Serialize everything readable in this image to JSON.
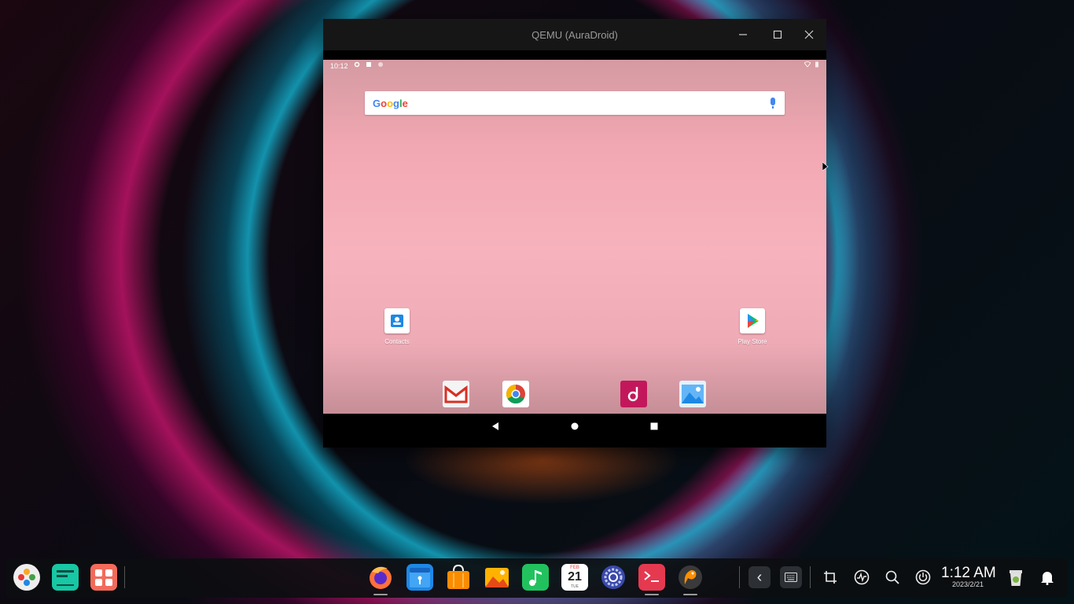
{
  "window": {
    "title": "QEMU (AuraDroid)",
    "minimize_glyph": "—",
    "maximize_glyph": "☐",
    "close_glyph": "✕"
  },
  "android": {
    "status_time": "10:12",
    "search_logo": "Google",
    "wallpaper_colors": [
      "#d49aa2",
      "#f7b3bd",
      "#c58e97"
    ],
    "home_apps": [
      {
        "label": "Contacts",
        "icon": "contacts-icon"
      },
      {
        "label": "Play Store",
        "icon": "play-store-icon"
      }
    ],
    "dock_apps": [
      {
        "icon": "gmail-icon"
      },
      {
        "icon": "chrome-icon"
      },
      {
        "icon": "music-icon"
      },
      {
        "icon": "gallery-icon"
      }
    ]
  },
  "taskbar": {
    "left_apps": [
      {
        "icon": "launcher-icon",
        "color": "#e9e9e9"
      },
      {
        "icon": "multitask-view-icon",
        "color": "#18c7a4"
      },
      {
        "icon": "app-store-icon",
        "color": "#f26b5b"
      }
    ],
    "pinned_apps": [
      {
        "icon": "firefox-icon"
      },
      {
        "icon": "file-manager-icon"
      },
      {
        "icon": "store-bag-icon"
      },
      {
        "icon": "image-viewer-icon"
      },
      {
        "icon": "music-player-icon"
      },
      {
        "icon": "calendar-icon",
        "month": "FEB",
        "day": "21",
        "weekday": "TUE"
      },
      {
        "icon": "settings-icon"
      },
      {
        "icon": "terminal-icon"
      },
      {
        "icon": "qemu-icon"
      }
    ],
    "tray": {
      "back_glyph": "‹",
      "clock_time": "1:12 AM",
      "clock_date": "2023/2/21"
    }
  }
}
